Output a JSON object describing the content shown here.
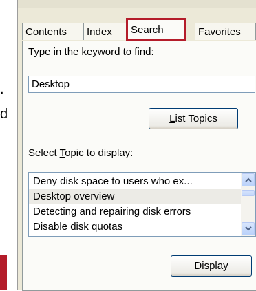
{
  "background_text": {
    "dot": ".",
    "letter": "d"
  },
  "tabs": [
    {
      "label_u": "C",
      "label_rest": "ontents"
    },
    {
      "label_pre": "I",
      "label_u": "n",
      "label_rest": "dex"
    },
    {
      "label_u": "S",
      "label_rest": "earch"
    },
    {
      "label_pre": "Favo",
      "label_u": "r",
      "label_rest": "ites"
    }
  ],
  "active_tab": "Search",
  "search": {
    "prompt_pre": "Type in the key",
    "prompt_u": "w",
    "prompt_rest": "ord to find:",
    "value": "Desktop",
    "list_topics_u": "L",
    "list_topics_rest": "ist Topics"
  },
  "topics": {
    "label_pre": "Select ",
    "label_u": "T",
    "label_rest": "opic to display:",
    "items": [
      "Deny disk space to users who ex...",
      "Desktop overview",
      "Detecting and repairing disk errors",
      "Disable disk quotas"
    ],
    "selected_index": 1
  },
  "display_button": {
    "label_u": "D",
    "label_rest": "isplay"
  },
  "colors": {
    "highlight": "#b41c2a",
    "panel": "#ece9d8",
    "tab_body": "#fbfbf8"
  },
  "icons": [
    "scroll-up-arrow-icon",
    "scroll-down-arrow-icon"
  ]
}
